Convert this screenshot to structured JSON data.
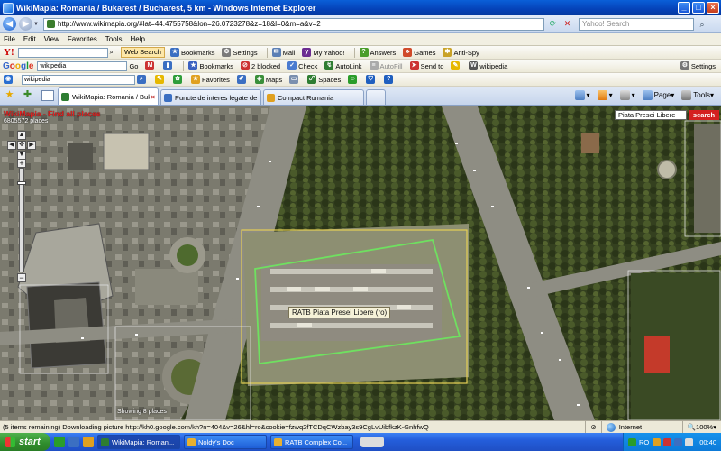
{
  "window": {
    "title": "WikiMapia: Romania / Bukarest / Bucharest, 5 km - Windows Internet Explorer"
  },
  "address_bar": {
    "url": "http://www.wikimapia.org/#lat=44.4755758&lon=26.0723278&z=18&l=0&m=a&v=2",
    "search_placeholder": "Yahoo! Search"
  },
  "menu": [
    "File",
    "Edit",
    "View",
    "Favorites",
    "Tools",
    "Help"
  ],
  "yahoo_toolbar": {
    "web_search": "Web Search",
    "items": [
      "Bookmarks",
      "Settings",
      "Mail",
      "My Yahoo!",
      "Answers",
      "Games",
      "Anti-Spy"
    ]
  },
  "google_toolbar": {
    "query": "wikipedia",
    "go": "Go",
    "items": [
      "Bookmarks",
      "2 blocked",
      "Check",
      "AutoLink",
      "AutoFill",
      "Send to",
      "wikipedia"
    ],
    "settings": "Settings"
  },
  "third_toolbar": {
    "query": "wikipedia",
    "items": [
      "Favorites",
      "Maps",
      "Spaces"
    ]
  },
  "tabs": [
    {
      "label": "WikiMapia: Romania / Buk...",
      "active": true,
      "color": "#2e7d32"
    },
    {
      "label": "Puncte de interes legate de tr...",
      "active": false,
      "color": "#3b6fc2"
    },
    {
      "label": "Compact Romania",
      "active": false,
      "color": "#e0a020"
    }
  ],
  "tab_tools": [
    "Page",
    "Tools"
  ],
  "map": {
    "site_title": "WikiMapia - Find all places",
    "place_count": "6805572 places",
    "search_value": "Piata Presei Libere",
    "search_button": "search",
    "selected_place": "RATB Piata Presei Libere (ro)",
    "showing": "Showing 8 places"
  },
  "status": {
    "message": "(5 items remaining) Downloading picture http://kh0.google.com/kh?n=404&v=26&hl=ro&cookie=fzwq2fTCDqCWzbay3s9CgLvUibfkzK-GnhfwQ",
    "zone": "Internet",
    "zoom": "100%"
  },
  "taskbar": {
    "start": "start",
    "tasks": [
      {
        "label": "WikiMapia: Roman...",
        "color": "#2e7d32",
        "active": true
      },
      {
        "label": "Noldy's Doc",
        "color": "#e8b030",
        "active": false
      },
      {
        "label": "RATB Complex Co...",
        "color": "#e8b030",
        "active": false
      }
    ],
    "lang": "RO",
    "clock": "00:40"
  }
}
